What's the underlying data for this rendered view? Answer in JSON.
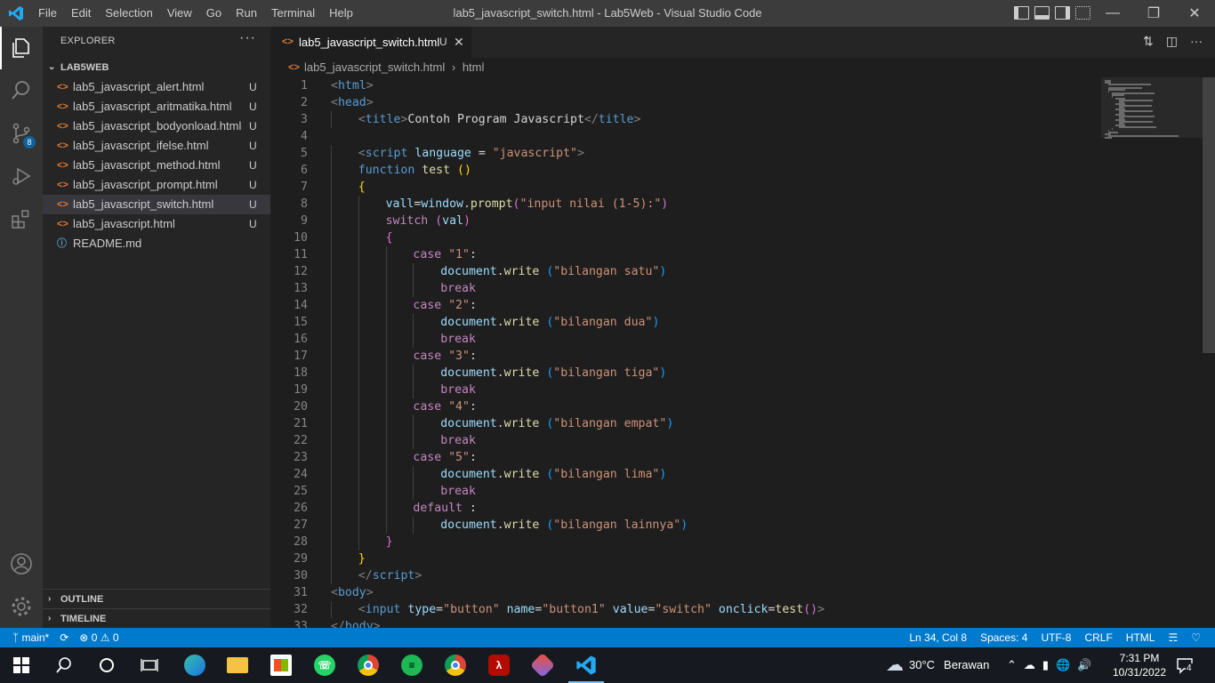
{
  "titlebar": {
    "menus": [
      "File",
      "Edit",
      "Selection",
      "View",
      "Go",
      "Run",
      "Terminal",
      "Help"
    ],
    "title": "lab5_javascript_switch.html - Lab5Web - Visual Studio Code"
  },
  "activity": {
    "scm_badge": "8"
  },
  "sidebar": {
    "title": "EXPLORER",
    "folder": "LAB5WEB",
    "files": [
      {
        "name": "lab5_javascript_alert.html",
        "status": "U"
      },
      {
        "name": "lab5_javascript_aritmatika.html",
        "status": "U"
      },
      {
        "name": "lab5_javascript_bodyonload.html",
        "status": "U"
      },
      {
        "name": "lab5_javascript_ifelse.html",
        "status": "U"
      },
      {
        "name": "lab5_javascript_method.html",
        "status": "U"
      },
      {
        "name": "lab5_javascript_prompt.html",
        "status": "U"
      },
      {
        "name": "lab5_javascript_switch.html",
        "status": "U"
      },
      {
        "name": "lab5_javascript.html",
        "status": "U"
      },
      {
        "name": "README.md",
        "status": ""
      }
    ],
    "outline": "OUTLINE",
    "timeline": "TIMELINE"
  },
  "editor": {
    "tab": {
      "label": "lab5_javascript_switch.html",
      "modified": "U"
    },
    "breadcrumb": {
      "file": "lab5_javascript_switch.html",
      "node": "html"
    },
    "lines": [
      {
        "n": "1",
        "indent": 0,
        "tokens": [
          [
            "tag",
            "<"
          ],
          [
            "name",
            "html"
          ],
          [
            "tag",
            ">"
          ]
        ]
      },
      {
        "n": "2",
        "indent": 0,
        "tokens": [
          [
            "tag",
            "<"
          ],
          [
            "name",
            "head"
          ],
          [
            "tag",
            ">"
          ]
        ]
      },
      {
        "n": "3",
        "indent": 1,
        "tokens": [
          [
            "tag",
            "<"
          ],
          [
            "name",
            "title"
          ],
          [
            "tag",
            ">"
          ],
          [
            "txt",
            "Contoh Program Javascript"
          ],
          [
            "tag",
            "</"
          ],
          [
            "name",
            "title"
          ],
          [
            "tag",
            ">"
          ]
        ]
      },
      {
        "n": "4",
        "indent": 0,
        "tokens": []
      },
      {
        "n": "5",
        "indent": 1,
        "tokens": [
          [
            "tag",
            "<"
          ],
          [
            "name",
            "script"
          ],
          [
            "txt",
            " "
          ],
          [
            "attr",
            "language"
          ],
          [
            "txt",
            " = "
          ],
          [
            "str",
            "\"javascript\""
          ],
          [
            "tag",
            ">"
          ]
        ]
      },
      {
        "n": "6",
        "indent": 1,
        "tokens": [
          [
            "kw",
            "function"
          ],
          [
            "txt",
            " "
          ],
          [
            "fn",
            "test"
          ],
          [
            "txt",
            " "
          ],
          [
            "br1",
            "()"
          ]
        ]
      },
      {
        "n": "7",
        "indent": 1,
        "tokens": [
          [
            "br1",
            "{"
          ]
        ]
      },
      {
        "n": "8",
        "indent": 2,
        "tokens": [
          [
            "var",
            "vall"
          ],
          [
            "txt",
            "="
          ],
          [
            "var",
            "window"
          ],
          [
            "txt",
            "."
          ],
          [
            "fn",
            "prompt"
          ],
          [
            "br2",
            "("
          ],
          [
            "str",
            "\"input nilai (1-5):\""
          ],
          [
            "br2",
            ")"
          ]
        ]
      },
      {
        "n": "9",
        "indent": 2,
        "tokens": [
          [
            "ctl",
            "switch"
          ],
          [
            "txt",
            " "
          ],
          [
            "br2",
            "("
          ],
          [
            "var",
            "val"
          ],
          [
            "br2",
            ")"
          ]
        ]
      },
      {
        "n": "10",
        "indent": 2,
        "tokens": [
          [
            "br2",
            "{"
          ]
        ]
      },
      {
        "n": "11",
        "indent": 3,
        "tokens": [
          [
            "ctl",
            "case"
          ],
          [
            "txt",
            " "
          ],
          [
            "str",
            "\"1\""
          ],
          [
            "txt",
            ":"
          ]
        ]
      },
      {
        "n": "12",
        "indent": 4,
        "tokens": [
          [
            "var",
            "document"
          ],
          [
            "txt",
            "."
          ],
          [
            "fn",
            "write"
          ],
          [
            "txt",
            " "
          ],
          [
            "br3",
            "("
          ],
          [
            "str",
            "\"bilangan satu\""
          ],
          [
            "br3",
            ")"
          ]
        ]
      },
      {
        "n": "13",
        "indent": 4,
        "tokens": [
          [
            "ctl",
            "break"
          ]
        ]
      },
      {
        "n": "14",
        "indent": 3,
        "tokens": [
          [
            "ctl",
            "case"
          ],
          [
            "txt",
            " "
          ],
          [
            "str",
            "\"2\""
          ],
          [
            "txt",
            ":"
          ]
        ]
      },
      {
        "n": "15",
        "indent": 4,
        "tokens": [
          [
            "var",
            "document"
          ],
          [
            "txt",
            "."
          ],
          [
            "fn",
            "write"
          ],
          [
            "txt",
            " "
          ],
          [
            "br3",
            "("
          ],
          [
            "str",
            "\"bilangan dua\""
          ],
          [
            "br3",
            ")"
          ]
        ]
      },
      {
        "n": "16",
        "indent": 4,
        "tokens": [
          [
            "ctl",
            "break"
          ]
        ]
      },
      {
        "n": "17",
        "indent": 3,
        "tokens": [
          [
            "ctl",
            "case"
          ],
          [
            "txt",
            " "
          ],
          [
            "str",
            "\"3\""
          ],
          [
            "txt",
            ":"
          ]
        ]
      },
      {
        "n": "18",
        "indent": 4,
        "tokens": [
          [
            "var",
            "document"
          ],
          [
            "txt",
            "."
          ],
          [
            "fn",
            "write"
          ],
          [
            "txt",
            " "
          ],
          [
            "br3",
            "("
          ],
          [
            "str",
            "\"bilangan tiga\""
          ],
          [
            "br3",
            ")"
          ]
        ]
      },
      {
        "n": "19",
        "indent": 4,
        "tokens": [
          [
            "ctl",
            "break"
          ]
        ]
      },
      {
        "n": "20",
        "indent": 3,
        "tokens": [
          [
            "ctl",
            "case"
          ],
          [
            "txt",
            " "
          ],
          [
            "str",
            "\"4\""
          ],
          [
            "txt",
            ":"
          ]
        ]
      },
      {
        "n": "21",
        "indent": 4,
        "tokens": [
          [
            "var",
            "document"
          ],
          [
            "txt",
            "."
          ],
          [
            "fn",
            "write"
          ],
          [
            "txt",
            " "
          ],
          [
            "br3",
            "("
          ],
          [
            "str",
            "\"bilangan empat\""
          ],
          [
            "br3",
            ")"
          ]
        ]
      },
      {
        "n": "22",
        "indent": 4,
        "tokens": [
          [
            "ctl",
            "break"
          ]
        ]
      },
      {
        "n": "23",
        "indent": 3,
        "tokens": [
          [
            "ctl",
            "case"
          ],
          [
            "txt",
            " "
          ],
          [
            "str",
            "\"5\""
          ],
          [
            "txt",
            ":"
          ]
        ]
      },
      {
        "n": "24",
        "indent": 4,
        "tokens": [
          [
            "var",
            "document"
          ],
          [
            "txt",
            "."
          ],
          [
            "fn",
            "write"
          ],
          [
            "txt",
            " "
          ],
          [
            "br3",
            "("
          ],
          [
            "str",
            "\"bilangan lima\""
          ],
          [
            "br3",
            ")"
          ]
        ]
      },
      {
        "n": "25",
        "indent": 4,
        "tokens": [
          [
            "ctl",
            "break"
          ]
        ]
      },
      {
        "n": "26",
        "indent": 3,
        "tokens": [
          [
            "ctl",
            "default"
          ],
          [
            "txt",
            " :"
          ]
        ]
      },
      {
        "n": "27",
        "indent": 4,
        "tokens": [
          [
            "var",
            "document"
          ],
          [
            "txt",
            "."
          ],
          [
            "fn",
            "write"
          ],
          [
            "txt",
            " "
          ],
          [
            "br3",
            "("
          ],
          [
            "str",
            "\"bilangan lainnya\""
          ],
          [
            "br3",
            ")"
          ]
        ]
      },
      {
        "n": "28",
        "indent": 2,
        "tokens": [
          [
            "br2",
            "}"
          ]
        ]
      },
      {
        "n": "29",
        "indent": 1,
        "tokens": [
          [
            "br1",
            "}"
          ]
        ]
      },
      {
        "n": "30",
        "indent": 1,
        "tokens": [
          [
            "tag",
            "</"
          ],
          [
            "name",
            "script"
          ],
          [
            "tag",
            ">"
          ]
        ]
      },
      {
        "n": "31",
        "indent": 0,
        "tokens": [
          [
            "tag",
            "<"
          ],
          [
            "name",
            "body"
          ],
          [
            "tag",
            ">"
          ]
        ]
      },
      {
        "n": "32",
        "indent": 1,
        "tokens": [
          [
            "tag",
            "<"
          ],
          [
            "name",
            "input"
          ],
          [
            "txt",
            " "
          ],
          [
            "attr",
            "type"
          ],
          [
            "txt",
            "="
          ],
          [
            "str",
            "\"button\""
          ],
          [
            "txt",
            " "
          ],
          [
            "attr",
            "name"
          ],
          [
            "txt",
            "="
          ],
          [
            "str",
            "\"button1\""
          ],
          [
            "txt",
            " "
          ],
          [
            "attr",
            "value"
          ],
          [
            "txt",
            "="
          ],
          [
            "str",
            "\"switch\""
          ],
          [
            "txt",
            " "
          ],
          [
            "attr",
            "onclick"
          ],
          [
            "txt",
            "="
          ],
          [
            "fn",
            "test"
          ],
          [
            "br2",
            "()"
          ],
          [
            "tag",
            ">"
          ]
        ]
      },
      {
        "n": "33",
        "indent": 0,
        "tokens": [
          [
            "tag",
            "</"
          ],
          [
            "name",
            "body"
          ],
          [
            "tag",
            ">"
          ]
        ]
      }
    ]
  },
  "statusbar": {
    "branch": "main*",
    "errors": "0",
    "warnings": "0",
    "position": "Ln 34, Col 8",
    "spaces": "Spaces: 4",
    "encoding": "UTF-8",
    "eol": "CRLF",
    "language": "HTML"
  },
  "taskbar": {
    "weather_temp": "30°C",
    "weather_desc": "Berawan",
    "time": "7:31 PM",
    "date": "10/31/2022",
    "notifications": "4"
  },
  "colors": {
    "accent": "#007acc",
    "tab_icon_html": "#e37933",
    "activity_bar": "#333333",
    "sidebar": "#252526",
    "editor_bg": "#1e1e1e"
  }
}
